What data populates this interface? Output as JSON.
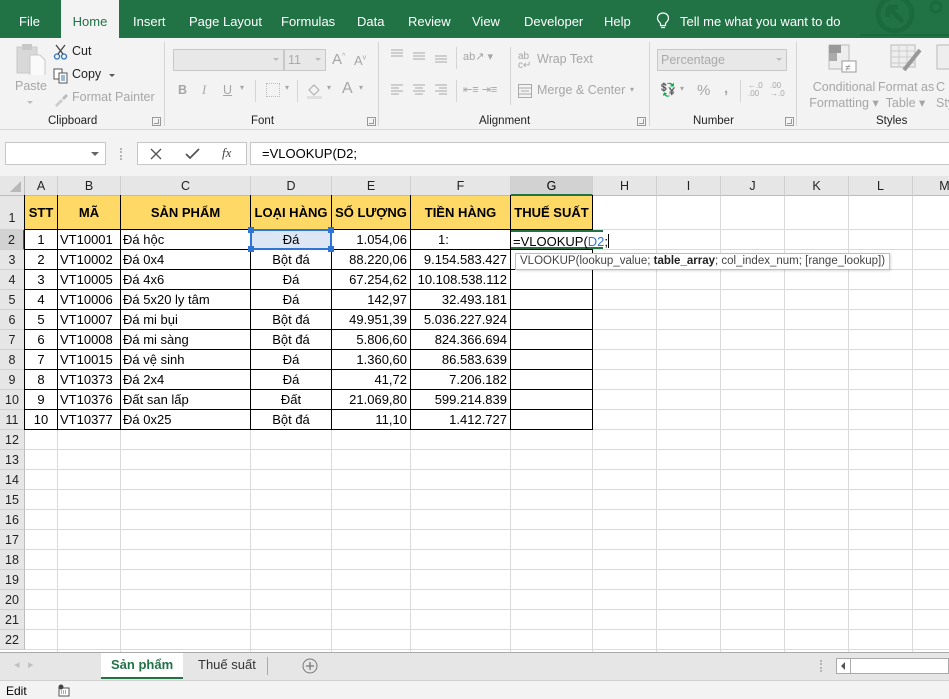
{
  "menu": {
    "tabs": [
      {
        "label": "File",
        "active": false
      },
      {
        "label": "Home",
        "active": true
      },
      {
        "label": "Insert",
        "active": false
      },
      {
        "label": "Page Layout",
        "active": false
      },
      {
        "label": "Formulas",
        "active": false
      },
      {
        "label": "Data",
        "active": false
      },
      {
        "label": "Review",
        "active": false
      },
      {
        "label": "View",
        "active": false
      },
      {
        "label": "Developer",
        "active": false
      },
      {
        "label": "Help",
        "active": false
      }
    ],
    "tell_me": "Tell me what you want to do"
  },
  "ribbon": {
    "clipboard": {
      "paste": "Paste",
      "cut": "Cut",
      "copy": "Copy",
      "format_painter": "Format Painter",
      "label": "Clipboard"
    },
    "font": {
      "font_name": "",
      "font_size": "11",
      "bold": "B",
      "italic": "I",
      "underline": "U",
      "label": "Font"
    },
    "alignment": {
      "wrap_text": "Wrap Text",
      "merge_center": "Merge & Center",
      "label": "Alignment"
    },
    "number": {
      "format": "Percentage",
      "percent": "%",
      "comma": ",",
      "label": "Number"
    },
    "styles": {
      "conditional_1": "Conditional",
      "conditional_2": "Formatting",
      "format_table_1": "Format as",
      "format_table_2": "Table",
      "cell_styles_1": "C",
      "cell_styles_2": "Sty",
      "label": "Styles"
    }
  },
  "formula_bar": {
    "name_box": "",
    "fx": "fx",
    "formula": "=VLOOKUP(D2;"
  },
  "sheet": {
    "columns": [
      "A",
      "B",
      "C",
      "D",
      "E",
      "F",
      "G",
      "H",
      "I",
      "J",
      "K",
      "L",
      "M"
    ],
    "selected_column": "G",
    "selected_row": 2,
    "headers": [
      "STT",
      "MÃ",
      "SẢN PHẨM",
      "LOẠI HÀNG",
      "SỐ LƯỢNG",
      "TIỀN HÀNG",
      "THUẾ SUẤT"
    ],
    "rows": [
      [
        "1",
        "VT10001",
        "Đá hộc",
        "Đá",
        "1.054,06",
        "1:"
      ],
      [
        "2",
        "VT10002",
        "Đá 0x4",
        "Bột đá",
        "88.220,06",
        "9.154.583.427"
      ],
      [
        "3",
        "VT10005",
        "Đá 4x6",
        "Đá",
        "67.254,62",
        "10.108.538.112"
      ],
      [
        "4",
        "VT10006",
        "Đá 5x20 ly tâm",
        "Đá",
        "142,97",
        "32.493.181"
      ],
      [
        "5",
        "VT10007",
        "Đá mi bụi",
        "Bột đá",
        "49.951,39",
        "5.036.227.924"
      ],
      [
        "6",
        "VT10008",
        "Đá mi sàng",
        "Bột đá",
        "5.806,60",
        "824.366.694"
      ],
      [
        "7",
        "VT10015",
        "Đá vệ sinh",
        "Đá",
        "1.360,60",
        "86.583.639"
      ],
      [
        "8",
        "VT10373",
        "Đá 2x4",
        "Đá",
        "41,72",
        "7.206.182"
      ],
      [
        "9",
        "VT10376",
        "Đất san lấp",
        "Đất",
        "21.069,80",
        "599.214.839"
      ],
      [
        "10",
        "VT10377",
        "Đá 0x25",
        "Bột đá",
        "11,10",
        "1.412.727"
      ]
    ],
    "row_numbers": [
      "1",
      "2",
      "3",
      "4",
      "5",
      "6",
      "7",
      "8",
      "9",
      "10",
      "11",
      "12",
      "13",
      "14",
      "15",
      "16",
      "17",
      "18",
      "19",
      "20",
      "21",
      "22"
    ],
    "edit_cell": {
      "prefix": "=VLOOKUP(",
      "ref": "D2",
      "suffix": ";"
    },
    "tooltip": {
      "fn": "VLOOKUP(",
      "a1": "lookup_value; ",
      "a2": "table_array",
      "a3": "; col_index_num; [range_lookup])"
    }
  },
  "sheet_tabs": [
    {
      "label": "Sản phẩm",
      "active": true
    },
    {
      "label": "Thuế suất",
      "active": false
    }
  ],
  "status": {
    "mode": "Edit"
  },
  "colors": {
    "brand": "#217346",
    "header_fill": "#ffd966",
    "ref_blue": "#2e75d6"
  }
}
